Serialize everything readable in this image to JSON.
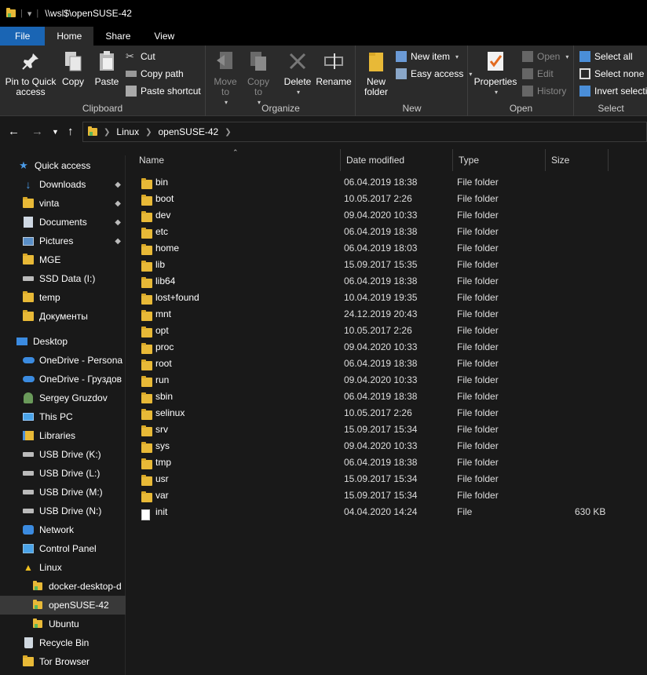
{
  "window": {
    "title": "\\\\wsl$\\openSUSE-42"
  },
  "tabs": [
    {
      "label": "File"
    },
    {
      "label": "Home"
    },
    {
      "label": "Share"
    },
    {
      "label": "View"
    }
  ],
  "ribbon": {
    "clipboard": {
      "label": "Clipboard",
      "pin": "Pin to Quick access",
      "copy": "Copy",
      "paste": "Paste",
      "cut": "Cut",
      "copy_path": "Copy path",
      "paste_shortcut": "Paste shortcut"
    },
    "organize": {
      "label": "Organize",
      "move_to": "Move to",
      "copy_to": "Copy to",
      "delete": "Delete",
      "rename": "Rename"
    },
    "new": {
      "label": "New",
      "new_folder": "New folder",
      "new_item": "New item",
      "easy_access": "Easy access"
    },
    "open": {
      "label": "Open",
      "properties": "Properties",
      "open": "Open",
      "edit": "Edit",
      "history": "History"
    },
    "select": {
      "label": "Select",
      "select_all": "Select all",
      "select_none": "Select none",
      "invert_selection": "Invert selection"
    }
  },
  "address": {
    "crumbs": [
      "Linux",
      "openSUSE-42"
    ]
  },
  "sidebar": {
    "items": [
      {
        "label": "Quick access",
        "icon": "star-icon"
      },
      {
        "label": "Downloads",
        "icon": "download-icon",
        "pinned": true
      },
      {
        "label": "vinta",
        "icon": "folder-icon",
        "pinned": true
      },
      {
        "label": "Documents",
        "icon": "documents-icon",
        "pinned": true
      },
      {
        "label": "Pictures",
        "icon": "pictures-icon",
        "pinned": true
      },
      {
        "label": "MGE",
        "icon": "folder-icon"
      },
      {
        "label": "SSD Data (I:)",
        "icon": "drive-icon"
      },
      {
        "label": "temp",
        "icon": "folder-icon"
      },
      {
        "label": "Документы",
        "icon": "folder-icon"
      },
      {
        "label": "Desktop",
        "icon": "desktop-icon"
      },
      {
        "label": "OneDrive - Persona",
        "icon": "onedrive-icon"
      },
      {
        "label": "OneDrive - Груздов",
        "icon": "onedrive-icon"
      },
      {
        "label": "Sergey Gruzdov",
        "icon": "user-icon"
      },
      {
        "label": "This PC",
        "icon": "pc-icon"
      },
      {
        "label": "Libraries",
        "icon": "libraries-icon"
      },
      {
        "label": "USB Drive (K:)",
        "icon": "drive-icon"
      },
      {
        "label": "USB Drive (L:)",
        "icon": "drive-icon"
      },
      {
        "label": "USB Drive (M:)",
        "icon": "drive-icon"
      },
      {
        "label": "USB Drive (N:)",
        "icon": "drive-icon"
      },
      {
        "label": "Network",
        "icon": "network-icon"
      },
      {
        "label": "Control Panel",
        "icon": "control-panel-icon"
      },
      {
        "label": "Linux",
        "icon": "linux-icon"
      },
      {
        "label": "docker-desktop-d",
        "icon": "wsl-folder-icon"
      },
      {
        "label": "openSUSE-42",
        "icon": "wsl-folder-icon",
        "selected": true
      },
      {
        "label": "Ubuntu",
        "icon": "wsl-folder-icon"
      },
      {
        "label": "Recycle Bin",
        "icon": "recycle-bin-icon"
      },
      {
        "label": "Tor Browser",
        "icon": "folder-icon"
      }
    ]
  },
  "columns": {
    "name": "Name",
    "date": "Date modified",
    "type": "Type",
    "size": "Size"
  },
  "files": [
    {
      "name": "bin",
      "date": "06.04.2019 18:38",
      "type": "File folder",
      "size": ""
    },
    {
      "name": "boot",
      "date": "10.05.2017 2:26",
      "type": "File folder",
      "size": ""
    },
    {
      "name": "dev",
      "date": "09.04.2020 10:33",
      "type": "File folder",
      "size": ""
    },
    {
      "name": "etc",
      "date": "06.04.2019 18:38",
      "type": "File folder",
      "size": ""
    },
    {
      "name": "home",
      "date": "06.04.2019 18:03",
      "type": "File folder",
      "size": ""
    },
    {
      "name": "lib",
      "date": "15.09.2017 15:35",
      "type": "File folder",
      "size": ""
    },
    {
      "name": "lib64",
      "date": "06.04.2019 18:38",
      "type": "File folder",
      "size": ""
    },
    {
      "name": "lost+found",
      "date": "10.04.2019 19:35",
      "type": "File folder",
      "size": ""
    },
    {
      "name": "mnt",
      "date": "24.12.2019 20:43",
      "type": "File folder",
      "size": ""
    },
    {
      "name": "opt",
      "date": "10.05.2017 2:26",
      "type": "File folder",
      "size": ""
    },
    {
      "name": "proc",
      "date": "09.04.2020 10:33",
      "type": "File folder",
      "size": ""
    },
    {
      "name": "root",
      "date": "06.04.2019 18:38",
      "type": "File folder",
      "size": ""
    },
    {
      "name": "run",
      "date": "09.04.2020 10:33",
      "type": "File folder",
      "size": ""
    },
    {
      "name": "sbin",
      "date": "06.04.2019 18:38",
      "type": "File folder",
      "size": ""
    },
    {
      "name": "selinux",
      "date": "10.05.2017 2:26",
      "type": "File folder",
      "size": ""
    },
    {
      "name": "srv",
      "date": "15.09.2017 15:34",
      "type": "File folder",
      "size": ""
    },
    {
      "name": "sys",
      "date": "09.04.2020 10:33",
      "type": "File folder",
      "size": ""
    },
    {
      "name": "tmp",
      "date": "06.04.2019 18:38",
      "type": "File folder",
      "size": ""
    },
    {
      "name": "usr",
      "date": "15.09.2017 15:34",
      "type": "File folder",
      "size": ""
    },
    {
      "name": "var",
      "date": "15.09.2017 15:34",
      "type": "File folder",
      "size": ""
    },
    {
      "name": "init",
      "date": "04.04.2020 14:24",
      "type": "File",
      "size": "630 KB"
    }
  ]
}
